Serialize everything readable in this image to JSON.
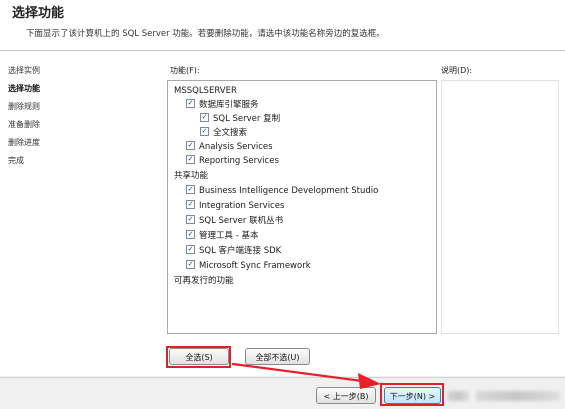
{
  "header": {
    "title": "选择功能",
    "subtitle": "下面显示了该计算机上的 SQL Server 功能。若要删除功能，请选中该功能名称旁边的复选框。"
  },
  "sidebar": {
    "items": [
      {
        "label": "选择实例",
        "active": false
      },
      {
        "label": "选择功能",
        "active": true
      },
      {
        "label": "删除规则",
        "active": false
      },
      {
        "label": "准备删除",
        "active": false
      },
      {
        "label": "删除进度",
        "active": false
      },
      {
        "label": "完成",
        "active": false
      }
    ]
  },
  "features": {
    "label": "功能(F):",
    "tree": [
      {
        "label": "MSSQLSERVER",
        "checkbox": false,
        "checked": false
      },
      {
        "label": "数据库引擎服务",
        "checkbox": true,
        "checked": true
      },
      {
        "label": "SQL Server 复制",
        "checkbox": true,
        "checked": true
      },
      {
        "label": "全文搜索",
        "checkbox": true,
        "checked": true
      },
      {
        "label": "Analysis Services",
        "checkbox": true,
        "checked": true
      },
      {
        "label": "Reporting Services",
        "checkbox": true,
        "checked": true
      },
      {
        "label": "共享功能",
        "checkbox": false,
        "checked": false
      },
      {
        "label": "Business Intelligence Development Studio",
        "checkbox": true,
        "checked": true
      },
      {
        "label": "Integration Services",
        "checkbox": true,
        "checked": true
      },
      {
        "label": "SQL Server 联机丛书",
        "checkbox": true,
        "checked": true
      },
      {
        "label": "管理工具 - 基本",
        "checkbox": true,
        "checked": true
      },
      {
        "label": "SQL 客户端连接 SDK",
        "checkbox": true,
        "checked": true
      },
      {
        "label": "Microsoft Sync Framework",
        "checkbox": true,
        "checked": true
      },
      {
        "label": "可再发行的功能",
        "checkbox": false,
        "checked": false
      }
    ]
  },
  "description": {
    "label": "说明(D):"
  },
  "buttons": {
    "select_all": "全选(S)",
    "unselect_all": "全部不选(U)",
    "back": "< 上一步(B)",
    "next": "下一步(N) >"
  },
  "colors": {
    "highlight": "#d9242c",
    "arrow": "#e8202a"
  },
  "icons": {
    "check": "check-icon",
    "arrow": "arrow-annotation-icon"
  }
}
